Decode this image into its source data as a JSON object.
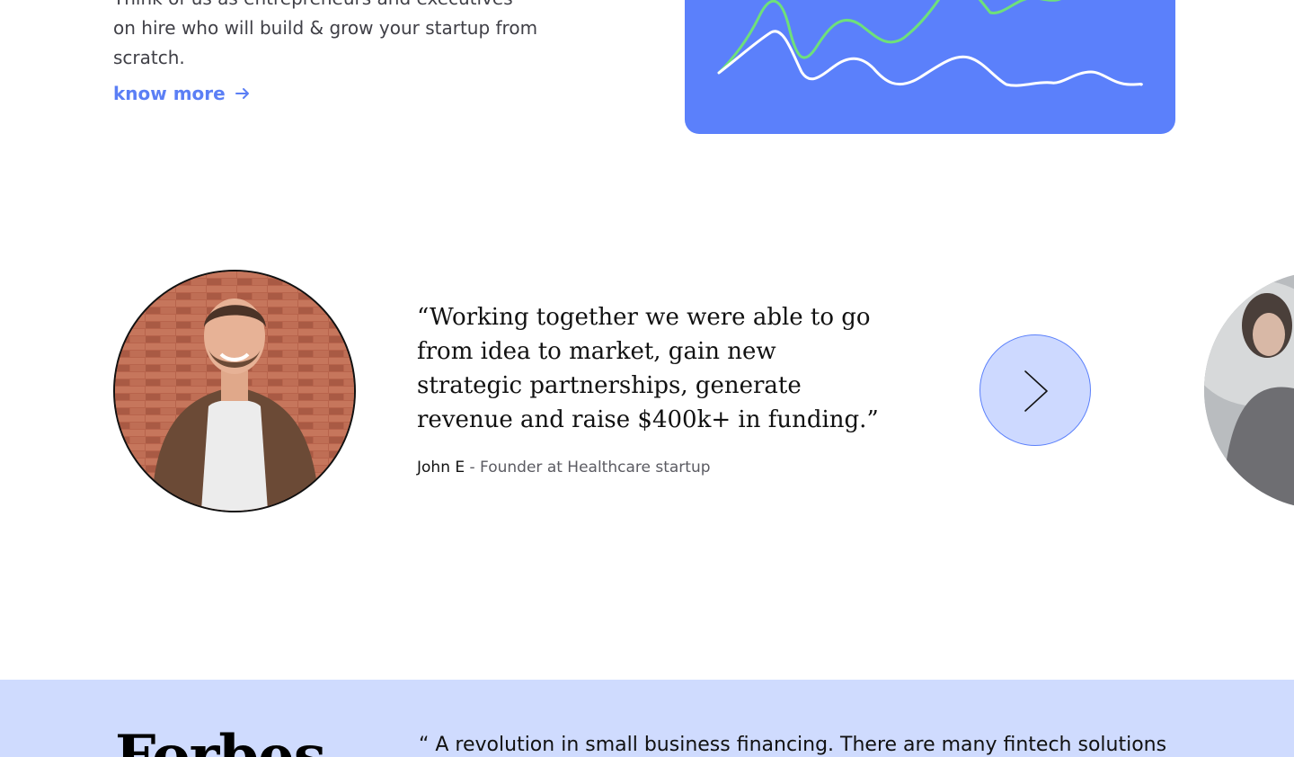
{
  "intro": {
    "line1": "Think of us as entrepreneurs and executives",
    "line2": "on hire who will build & grow your startup from",
    "line3": "scratch.",
    "link_label": "know more"
  },
  "chart_card": {
    "background": "#5b80fb",
    "series": [
      {
        "color": "#6ee07a"
      },
      {
        "color": "#ffffff"
      }
    ]
  },
  "testimonial": {
    "quote_lines": [
      "“Working together we were able to go",
      "from idea to market, gain new",
      "strategic partnerships, generate",
      "revenue and raise $400k+ in funding.”"
    ],
    "author_name": "John E",
    "author_role": " - Founder at Healthcare startup",
    "next_icon": "chevron-right-icon"
  },
  "press": {
    "logo_text": "Forbes",
    "quote": "“ A revolution in small business financing. There are many fintech solutions"
  },
  "colors": {
    "accent": "#5b7ff5",
    "band": "#cfdbfe",
    "button": "#cdd9ff"
  }
}
